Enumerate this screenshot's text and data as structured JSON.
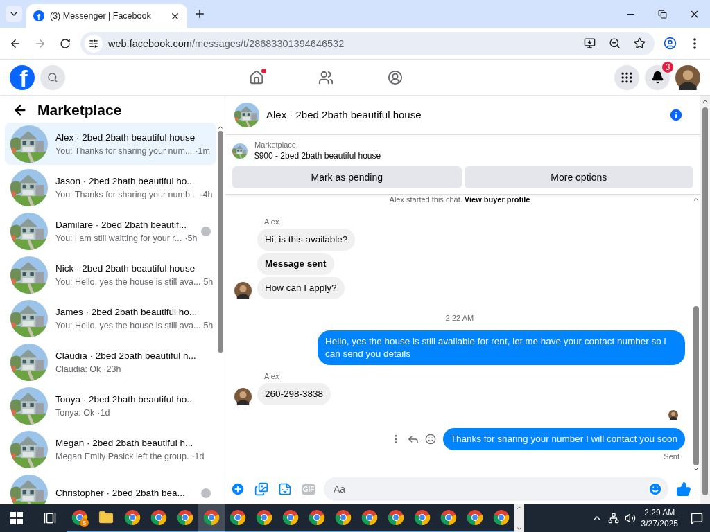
{
  "browser": {
    "tab_title": "(3) Messenger | Facebook",
    "favicon": "f",
    "url_host": "web.facebook.com",
    "url_path": "/messages/t/28683301394646532"
  },
  "topbar": {
    "logo": "f",
    "home_unread": true,
    "notifications_badge": "3"
  },
  "sidebar": {
    "title": "Marketplace",
    "conversations": [
      {
        "title": "Alex · 2bed 2bath beautiful house",
        "preview": "You: Thanks for sharing your num...",
        "time": "·1m",
        "selected": true,
        "seen_avatar": false
      },
      {
        "title": "Jason · 2bed 2bath beautiful ho...",
        "preview": "You: Thanks for sharing your numb...",
        "time": "·4h",
        "selected": false,
        "seen_avatar": false
      },
      {
        "title": "Damilare · 2bed 2bath beautif...",
        "preview": "You: i am still waitting for your r...",
        "time": "·5h",
        "selected": false,
        "seen_avatar": true
      },
      {
        "title": "Nick · 2bed 2bath beautiful house",
        "preview": "You: Hello, yes the house is still ava...",
        "time": "5h",
        "selected": false,
        "seen_avatar": false
      },
      {
        "title": "James · 2bed 2bath beautiful ho...",
        "preview": "You: Hello, yes the house is still ava...",
        "time": "5h",
        "selected": false,
        "seen_avatar": false
      },
      {
        "title": "Claudia · 2bed 2bath beautiful h...",
        "preview": "Claudia: Ok",
        "time": "·23h",
        "selected": false,
        "seen_avatar": false
      },
      {
        "title": "Tonya · 2bed 2bath beautiful ho...",
        "preview": "Tonya: Ok",
        "time": "·1d",
        "selected": false,
        "seen_avatar": false
      },
      {
        "title": "Megan · 2bed 2bath beautiful h...",
        "preview": "Megan Emily Pasick left the group.",
        "time": "·1d",
        "selected": false,
        "seen_avatar": false
      },
      {
        "title": "Christopher · 2bed 2bath bea...",
        "selected": false,
        "seen_avatar": true
      }
    ]
  },
  "chat": {
    "title": "Alex · 2bed 2bath beautiful house",
    "listing": {
      "label": "Marketplace",
      "title": "$900 - 2bed 2bath beautiful house"
    },
    "actions": [
      "Mark as pending",
      "More options"
    ],
    "started": {
      "text": "Alex started this chat.",
      "link": "View buyer profile"
    },
    "messages": [
      {
        "kind": "sender",
        "text": "Alex"
      },
      {
        "kind": "incoming",
        "text": "Hi, is this available?",
        "bold": false,
        "avatar": false
      },
      {
        "kind": "incoming",
        "text": "Message sent",
        "bold": true,
        "avatar": false
      },
      {
        "kind": "incoming",
        "text": "How can I apply?",
        "bold": false,
        "avatar": true
      },
      {
        "kind": "timestamp",
        "text": "2:22 AM"
      },
      {
        "kind": "outgoing",
        "text": "Hello, yes the house is still available for rent, let me have your contact number so i can send you  details",
        "actions": false
      },
      {
        "kind": "sender",
        "text": "Alex"
      },
      {
        "kind": "incoming",
        "text": "260-298-3838",
        "bold": false,
        "avatar": true
      },
      {
        "kind": "seen"
      },
      {
        "kind": "outgoing",
        "text": "Thanks for sharing your number I will contact you soon",
        "actions": true
      },
      {
        "kind": "status",
        "text": "Sent"
      }
    ],
    "composer": {
      "placeholder": "Aa",
      "gif": "GIF"
    }
  },
  "taskbar": {
    "apps": [
      {
        "kind": "chrome",
        "badge": "S",
        "selected": false
      },
      {
        "kind": "folder",
        "selected": false
      },
      {
        "kind": "chrome",
        "selected": false
      },
      {
        "kind": "chrome",
        "selected": false
      },
      {
        "kind": "chrome",
        "selected": false
      },
      {
        "kind": "chrome",
        "selected": true
      },
      {
        "kind": "chrome",
        "selected": false
      },
      {
        "kind": "chrome",
        "selected": false
      },
      {
        "kind": "chrome",
        "selected": false
      },
      {
        "kind": "chrome",
        "selected": false
      },
      {
        "kind": "chrome",
        "selected": false
      },
      {
        "kind": "chrome",
        "selected": false
      },
      {
        "kind": "chrome",
        "selected": false
      },
      {
        "kind": "chrome",
        "selected": false
      },
      {
        "kind": "chrome",
        "selected": false
      },
      {
        "kind": "chrome",
        "selected": false
      },
      {
        "kind": "chrome",
        "selected": false
      }
    ],
    "time": "2:29 AM",
    "date": "3/27/2025"
  }
}
